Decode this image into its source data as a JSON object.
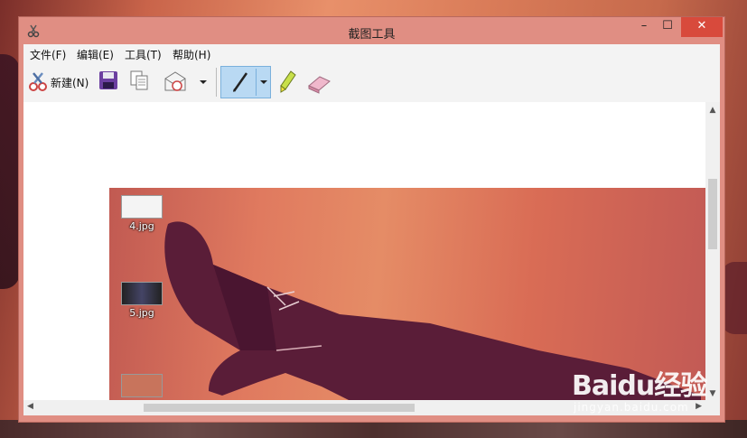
{
  "window": {
    "title": "截图工具",
    "controls": {
      "minimize": "–",
      "maximize": "☐",
      "close": "✕"
    }
  },
  "menu": {
    "items": [
      "文件(F)",
      "编辑(E)",
      "工具(T)",
      "帮助(H)"
    ]
  },
  "toolbar": {
    "new_label": "新建(N)",
    "buttons": [
      "scissors-icon",
      "save-icon",
      "copy-icon",
      "send-email-icon",
      "dropdown-arrow-icon",
      "pen-icon",
      "highlighter-icon",
      "eraser-icon"
    ],
    "active_tool": "pen"
  },
  "capture": {
    "desktop_icons": [
      {
        "label": "4.jpg"
      },
      {
        "label": "5.jpg"
      },
      {
        "label": ""
      }
    ]
  },
  "watermark": {
    "logo": "Baidu经验",
    "site": "jingyan.baidu.com"
  },
  "colors": {
    "title_bar": "#e08e83",
    "close_button": "#d84a3c",
    "pen_active": "#b9d9f3"
  }
}
